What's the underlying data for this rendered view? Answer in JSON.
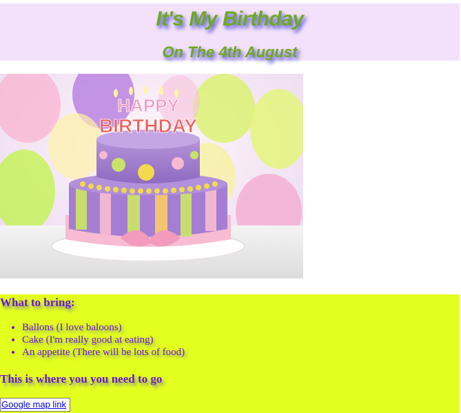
{
  "header": {
    "title": "It's My Birthday",
    "subtitle": "On The 4th August"
  },
  "image": {
    "cake_lettering": "HAPPY BIRTHDAY"
  },
  "bring": {
    "heading": "What to bring:",
    "items": [
      "Ballons (I love baloons)",
      "Cake (I'm really good at eating)",
      "An appetite (There will be lots of food)"
    ]
  },
  "location": {
    "heading": "This is where you you need to go",
    "link_label": "Google map link"
  },
  "colors": {
    "header_bg": "#f3e1fb",
    "title_green": "#6fa81d",
    "title_shadow": "#4b4bd6",
    "panel_bg": "#e2ff1f",
    "text_purple": "#6a18c8",
    "link_blue": "#0000ee"
  }
}
